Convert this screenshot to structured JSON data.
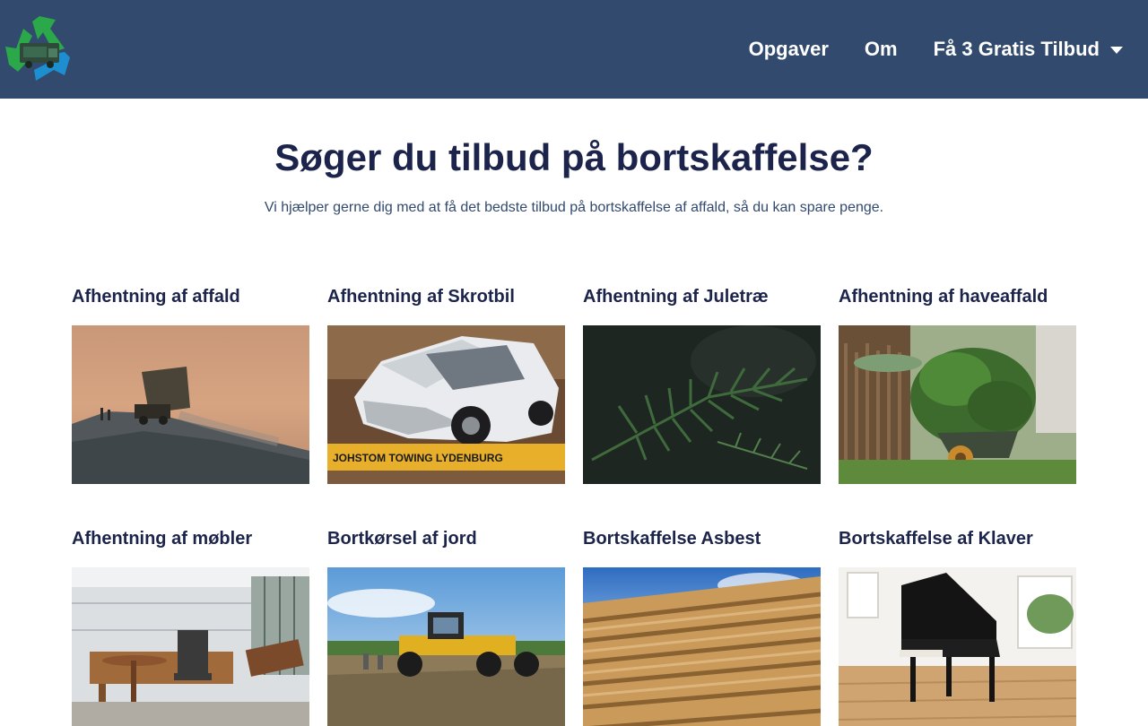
{
  "nav": {
    "items": [
      {
        "label": "Opgaver"
      },
      {
        "label": "Om"
      },
      {
        "label": "Få 3 Gratis Tilbud"
      }
    ]
  },
  "hero": {
    "title": "Søger du tilbud på bortskaffelse?",
    "subtitle": "Vi hjælper gerne dig med at få det bedste tilbud på bortskaffelse af affald, så du kan spare penge."
  },
  "cards": [
    {
      "title": "Afhentning af affald",
      "image": "landfill-dump-truck"
    },
    {
      "title": "Afhentning af Skrotbil",
      "image": "wrecked-car",
      "caption": "JOHSTOM TOWING  LYDENBURG"
    },
    {
      "title": "Afhentning af Juletræ",
      "image": "fir-branch"
    },
    {
      "title": "Afhentning af haveaffald",
      "image": "garden-wheelbarrow"
    },
    {
      "title": "Afhentning af møbler",
      "image": "old-furniture-room"
    },
    {
      "title": "Bortkørsel af jord",
      "image": "grader-on-soil"
    },
    {
      "title": "Bortskaffelse Asbest",
      "image": "corrugated-roof"
    },
    {
      "title": "Bortskaffelse af Klaver",
      "image": "grand-piano"
    }
  ]
}
